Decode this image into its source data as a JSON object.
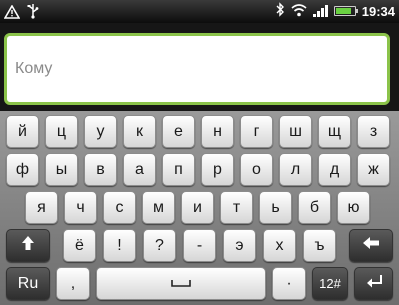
{
  "status_bar": {
    "time": "19:34",
    "icons": [
      "warning-icon",
      "usb-icon",
      "bluetooth-icon",
      "wifi-icon",
      "signal-icon",
      "battery-icon"
    ],
    "battery_level": 0.85,
    "signal_bars": 4
  },
  "compose": {
    "to_placeholder": "Кому",
    "accent_color": "#8bc34a"
  },
  "keyboard": {
    "row1": [
      "й",
      "ц",
      "у",
      "к",
      "е",
      "н",
      "г",
      "ш",
      "щ",
      "з"
    ],
    "row2": [
      "ф",
      "ы",
      "в",
      "а",
      "п",
      "р",
      "о",
      "л",
      "д",
      "ж"
    ],
    "row3": [
      "я",
      "ч",
      "с",
      "м",
      "и",
      "т",
      "ь",
      "б",
      "ю"
    ],
    "row4": [
      "ё",
      "!",
      "?",
      "-",
      "э",
      "х",
      "ъ"
    ],
    "lang_label": "Ru",
    "comma_label": ",",
    "period_label": "·",
    "num_label": "12#",
    "shift_icon": "shift-arrow-icon",
    "backspace_icon": "backspace-arrow-icon",
    "enter_icon": "enter-arrow-icon",
    "space_icon": "space-bar-icon"
  }
}
